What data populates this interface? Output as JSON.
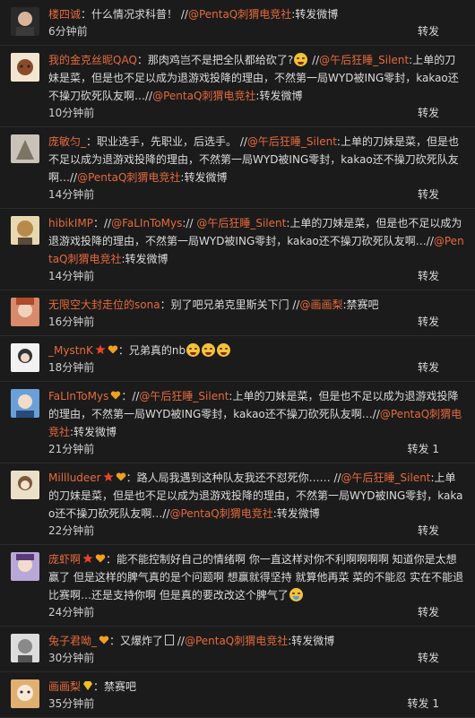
{
  "comments": [
    {
      "user": "楼四诚",
      "badge": "",
      "parts": [
        {
          "t": "：什么情况求科普！",
          "m": false
        },
        {
          "t": " //",
          "m": false
        },
        {
          "t": "@PentaQ刺猬电竞社",
          "m": true
        },
        {
          "t": ":转发微博",
          "m": false
        }
      ],
      "time": "6分钟前",
      "repost": "转发"
    },
    {
      "user": "我的金克丝昵QAQ",
      "badge": "",
      "parts": [
        {
          "t": "：那肉鸡岂不是把全队都给砍了?",
          "m": false
        },
        {
          "t": "EMOJI",
          "m": false
        },
        {
          "t": " //",
          "m": false
        },
        {
          "t": "@午后狂睡_Silent",
          "m": true
        },
        {
          "t": ":上单的刀妹是菜，但是也不足以成为退游戏投降的理由，不然第一局WYD被ING零封，kakao还不操刀砍死队友啊…//",
          "m": false
        },
        {
          "t": "@PentaQ刺猬电竞社",
          "m": true
        },
        {
          "t": ":转发微博",
          "m": false
        }
      ],
      "time": "10分钟前",
      "repost": "转发"
    },
    {
      "user": "庞敏匀_",
      "badge": "",
      "parts": [
        {
          "t": "：职业选手，先职业，后选手。 //",
          "m": false
        },
        {
          "t": "@午后狂睡_Silent",
          "m": true
        },
        {
          "t": ":上单的刀妹是菜，但是也不足以成为退游戏投降的理由，不然第一局WYD被ING零封，kakao还不操刀砍死队友啊…//",
          "m": false
        },
        {
          "t": "@PentaQ刺猬电竞社",
          "m": true
        },
        {
          "t": ":转发微博",
          "m": false
        }
      ],
      "time": "14分钟前",
      "repost": "转发"
    },
    {
      "user": "hibikIMP",
      "badge": "",
      "parts": [
        {
          "t": "：//",
          "m": false
        },
        {
          "t": "@FaLInToMys",
          "m": true
        },
        {
          "t": ":// ",
          "m": false
        },
        {
          "t": "@午后狂睡_Silent",
          "m": true
        },
        {
          "t": ":上单的刀妹是菜，但是也不足以成为退游戏投降的理由，不然第一局WYD被ING零封，kakao还不操刀砍死队友啊…//",
          "m": false
        },
        {
          "t": "@PentaQ刺猬电竞社",
          "m": true
        },
        {
          "t": ":转发微博",
          "m": false
        }
      ],
      "time": "14分钟前",
      "repost": "转发"
    },
    {
      "user": "无限空大封走位的sona",
      "badge": "",
      "parts": [
        {
          "t": "：别了吧兄弟克里斯关下门 //",
          "m": false
        },
        {
          "t": "@画画梨",
          "m": true
        },
        {
          "t": ":禁赛吧",
          "m": false
        }
      ],
      "time": "16分钟前",
      "repost": "转发"
    },
    {
      "user": "_MystnK",
      "badge": "star",
      "parts": [
        {
          "t": "：兄弟真的nb",
          "m": false
        },
        {
          "t": "EMOJI3",
          "m": false
        }
      ],
      "time": "18分钟前",
      "repost": "转发"
    },
    {
      "user": "FaLInToMys",
      "badge": "heart",
      "parts": [
        {
          "t": "：//",
          "m": false
        },
        {
          "t": "@午后狂睡_Silent",
          "m": true
        },
        {
          "t": ":上单的刀妹是菜，但是也不足以成为退游戏投降的理由，不然第一局WYD被ING零封，kakao还不操刀砍死队友啊…//",
          "m": false
        },
        {
          "t": "@PentaQ刺猬电竞社",
          "m": true
        },
        {
          "t": ":转发微博",
          "m": false
        }
      ],
      "time": "21分钟前",
      "repost": "转发 1"
    },
    {
      "user": "Millludeer",
      "badge": "star",
      "parts": [
        {
          "t": "：路人局我遇到这种队友我还不怼死你…… //",
          "m": false
        },
        {
          "t": "@午后狂睡_Silent",
          "m": true
        },
        {
          "t": ":上单的刀妹是菜，但是也不足以成为退游戏投降的理由，不然第一局WYD被ING零封，kakao还不操刀砍死队友啊…//",
          "m": false
        },
        {
          "t": "@PentaQ刺猬电竞社",
          "m": true
        },
        {
          "t": ":转发微博",
          "m": false
        }
      ],
      "time": "22分钟前",
      "repost": "转发"
    },
    {
      "user": "庞虾啊",
      "badge": "star",
      "parts": [
        {
          "t": "：能不能控制好自己的情绪啊 你一直这样对你不利啊啊啊啊 知道你是太想赢了 但是这样的脾气真的是个问题啊 想赢就得坚持 就算他再菜 菜的不能忍 实在不能退比赛啊…还是支持你啊 但是真的要改改这个脾气了",
          "m": false
        },
        {
          "t": "EMOJICRY",
          "m": false
        }
      ],
      "time": "24分钟前",
      "repost": "转发"
    },
    {
      "user": "兔子君呦_",
      "badge": "heart",
      "parts": [
        {
          "t": "：又爆炸了",
          "m": false
        },
        {
          "t": "BOX",
          "m": false
        },
        {
          "t": " //",
          "m": false
        },
        {
          "t": "@PentaQ刺猬电竞社",
          "m": true
        },
        {
          "t": ":转发微博",
          "m": false
        }
      ],
      "time": "30分钟前",
      "repost": "转发"
    },
    {
      "user": "画画梨",
      "badge": "gold",
      "parts": [
        {
          "t": "：禁赛吧",
          "m": false
        }
      ],
      "time": "35分钟前",
      "repost": "转发 1"
    }
  ],
  "colors": {
    "background": "#1b1b1b",
    "accent": "#e56a3d",
    "text": "#dcdcdc"
  }
}
